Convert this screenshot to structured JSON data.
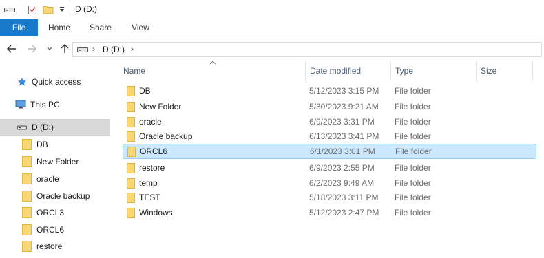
{
  "window": {
    "title": "D (D:)"
  },
  "ribbon": {
    "tabs": [
      "File",
      "Home",
      "Share",
      "View"
    ]
  },
  "address": {
    "path": "D (D:)"
  },
  "nav": {
    "quick_access": "Quick access",
    "this_pc": "This PC",
    "drive": "D (D:)",
    "folders": [
      "DB",
      "New Folder",
      "oracle",
      "Oracle backup",
      "ORCL3",
      "ORCL6",
      "restore"
    ]
  },
  "columns": {
    "name": "Name",
    "date": "Date modified",
    "type": "Type",
    "size": "Size"
  },
  "files": [
    {
      "name": "DB",
      "date": "5/12/2023 3:15 PM",
      "type": "File folder"
    },
    {
      "name": "New Folder",
      "date": "5/30/2023 9:21 AM",
      "type": "File folder"
    },
    {
      "name": "oracle",
      "date": "6/9/2023 3:31 PM",
      "type": "File folder"
    },
    {
      "name": "Oracle backup",
      "date": "6/13/2023 3:41 PM",
      "type": "File folder"
    },
    {
      "name": "ORCL6",
      "date": "6/1/2023 3:01 PM",
      "type": "File folder",
      "selected": true
    },
    {
      "name": "restore",
      "date": "6/9/2023 2:55 PM",
      "type": "File folder"
    },
    {
      "name": "temp",
      "date": "6/2/2023 9:49 AM",
      "type": "File folder"
    },
    {
      "name": "TEST",
      "date": "5/18/2023 3:11 PM",
      "type": "File folder"
    },
    {
      "name": "Windows",
      "date": "5/12/2023 2:47 PM",
      "type": "File folder"
    }
  ],
  "colors": {
    "accent": "#1979ca",
    "selection": "#cce8ff",
    "folder": "#f8d775"
  }
}
